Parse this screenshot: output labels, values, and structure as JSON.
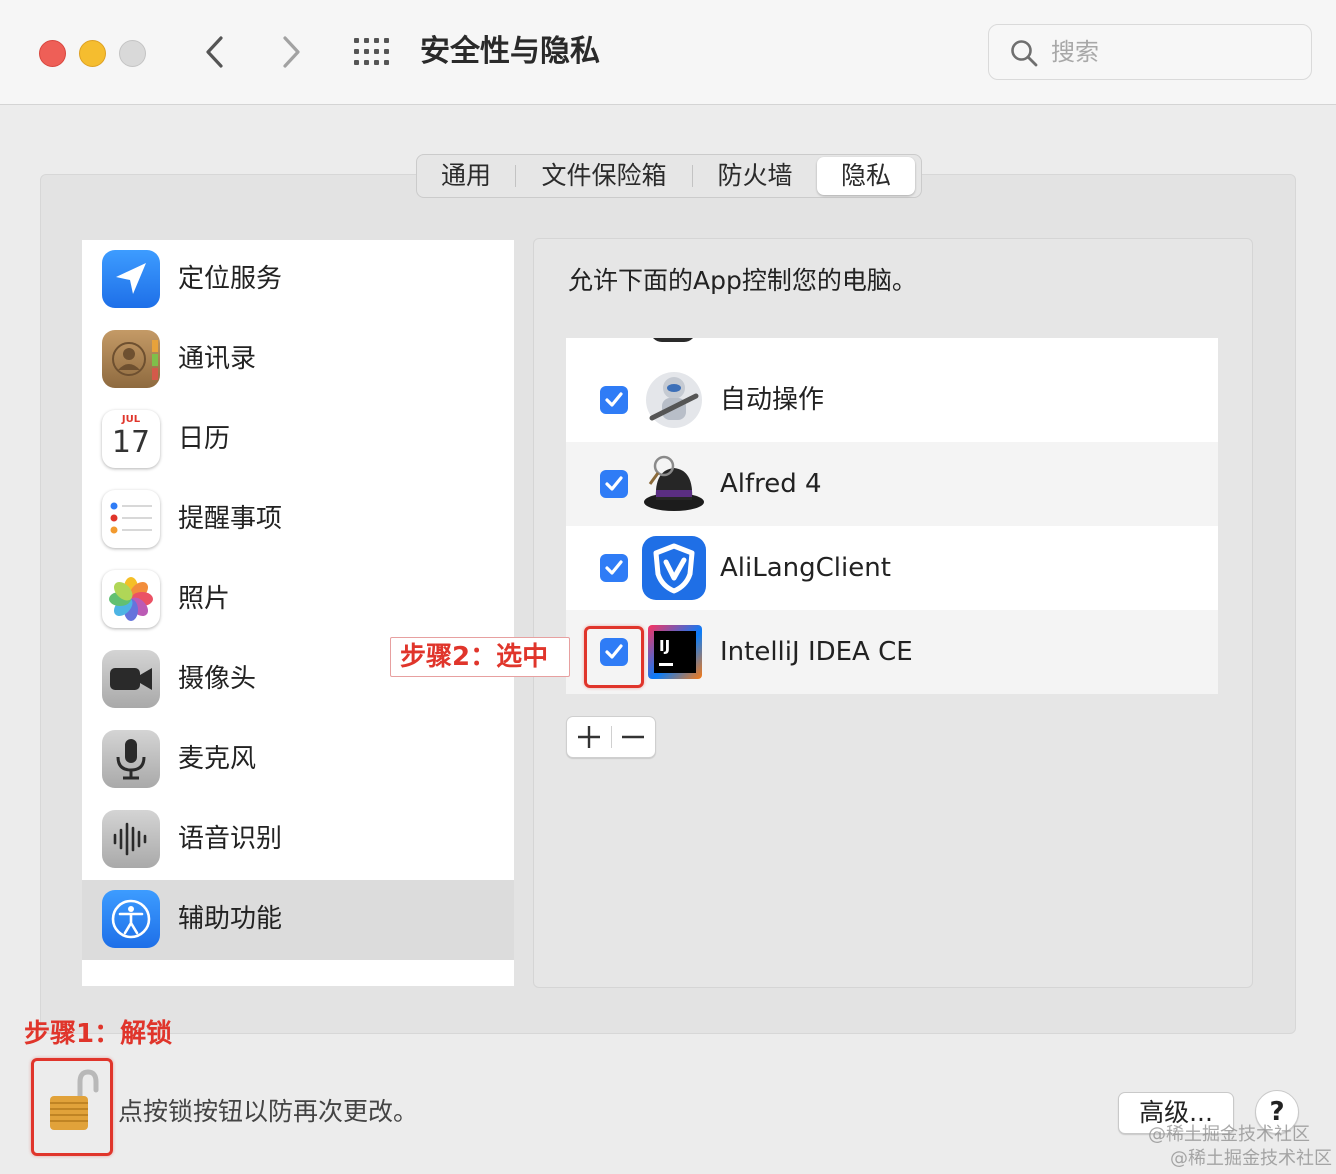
{
  "window": {
    "title": "安全性与隐私",
    "search_placeholder": "搜索"
  },
  "tabs": [
    {
      "label": "通用",
      "selected": false
    },
    {
      "label": "文件保险箱",
      "selected": false
    },
    {
      "label": "防火墙",
      "selected": false
    },
    {
      "label": "隐私",
      "selected": true
    }
  ],
  "sidebar": {
    "items": [
      {
        "label": "定位服务",
        "icon": "location-arrow-icon"
      },
      {
        "label": "通讯录",
        "icon": "contacts-icon"
      },
      {
        "label": "日历",
        "icon": "calendar-icon",
        "month": "JUL",
        "day": "17"
      },
      {
        "label": "提醒事项",
        "icon": "reminders-icon"
      },
      {
        "label": "照片",
        "icon": "photos-icon"
      },
      {
        "label": "摄像头",
        "icon": "camera-icon"
      },
      {
        "label": "麦克风",
        "icon": "microphone-icon"
      },
      {
        "label": "语音识别",
        "icon": "speech-recognition-icon"
      },
      {
        "label": "辅助功能",
        "icon": "accessibility-icon",
        "selected": true
      }
    ]
  },
  "privacy_pane": {
    "description": "允许下面的App控制您的电脑。",
    "apps": [
      {
        "name": "自动操作",
        "icon": "automator-icon",
        "checked": true
      },
      {
        "name": "Alfred 4",
        "icon": "alfred-icon",
        "checked": true
      },
      {
        "name": "AliLangClient",
        "icon": "alilang-shield-icon",
        "checked": true
      },
      {
        "name": "IntelliJ IDEA CE",
        "icon": "intellij-icon",
        "checked": true
      }
    ],
    "plus": "+",
    "minus": "−"
  },
  "annotations": {
    "step1": "步骤1：解锁",
    "step2": "步骤2：选中"
  },
  "footer": {
    "lock_text": "点按锁按钮以防再次更改。",
    "advanced_button": "高级...",
    "help_button": "?"
  },
  "watermark": "@稀土掘金技术社区",
  "colors": {
    "accent": "#2f7cf6",
    "annotation": "#e0352b"
  }
}
